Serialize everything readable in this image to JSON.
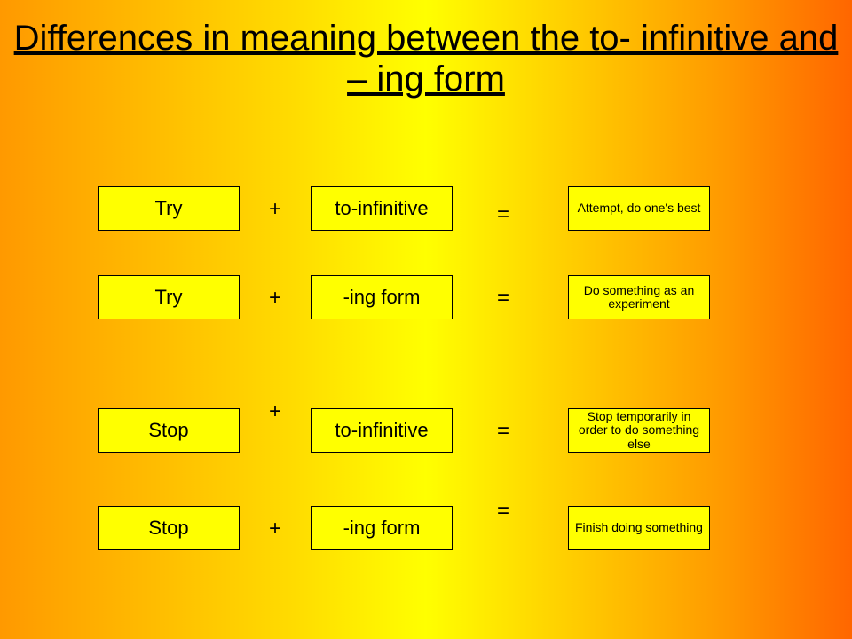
{
  "title": "Differences in meaning between the to- infinitive and – ing form",
  "rows": [
    {
      "verb": "Try",
      "plus": "+",
      "form": "to-infinitive",
      "eq": "=",
      "meaning": "Attempt, do one's best"
    },
    {
      "verb": "Try",
      "plus": "+",
      "form": "-ing form",
      "eq": "=",
      "meaning": "Do something as an experiment"
    },
    {
      "verb": "Stop",
      "plus": "+",
      "form": "to-infinitive",
      "eq": "=",
      "meaning": "Stop temporarily in order to do something else"
    },
    {
      "verb": "Stop",
      "plus": "+",
      "form": "-ing form",
      "eq": "=",
      "meaning": "Finish doing something"
    }
  ]
}
